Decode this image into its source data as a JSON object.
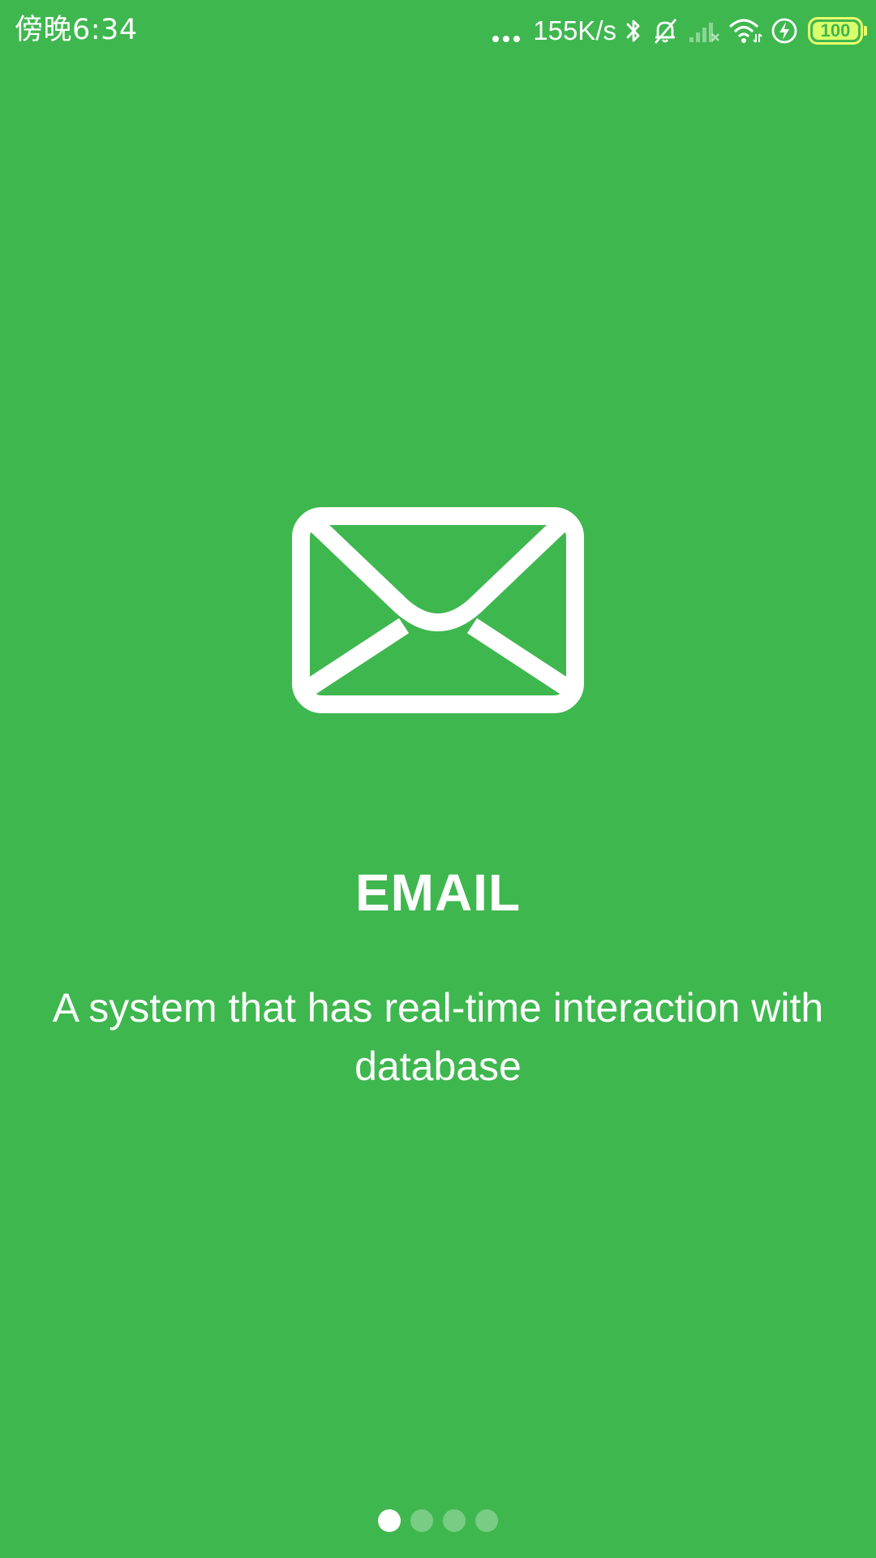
{
  "status_bar": {
    "time": "傍晚6:34",
    "network_speed": "155K/s",
    "battery_level": "100",
    "icons": [
      "more-dots-icon",
      "bluetooth-icon",
      "silent-bell-icon",
      "signal-icon",
      "wifi-icon",
      "charging-icon",
      "battery-icon"
    ]
  },
  "onboarding": {
    "icon": "envelope-icon",
    "title": "EMAIL",
    "description": "A system that has real-time interaction with database",
    "page_count": 4,
    "current_page": 1
  },
  "colors": {
    "background": "#3fb74f",
    "foreground": "#ffffff",
    "battery_accent": "#d9ff6a"
  }
}
